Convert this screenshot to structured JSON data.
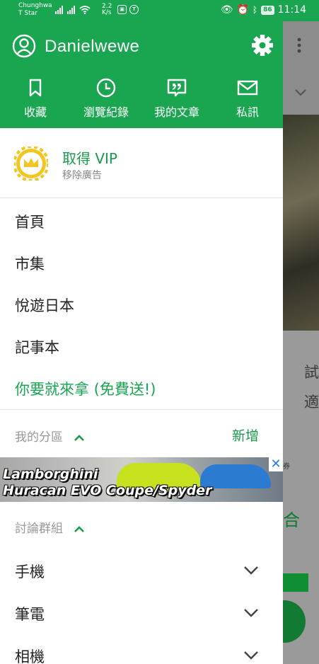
{
  "status_bar": {
    "carrier_line1": "Chunghwa",
    "carrier_line2": "T Star",
    "speed_value": "2.2",
    "speed_unit": "K/s",
    "battery": "86",
    "time": "11:14"
  },
  "drawer": {
    "username": "Danielwewe",
    "header_buttons": [
      {
        "label": "收藏",
        "icon": "bookmark-icon"
      },
      {
        "label": "瀏覽紀錄",
        "icon": "clock-icon"
      },
      {
        "label": "我的文章",
        "icon": "article-quote-icon"
      },
      {
        "label": "私訊",
        "icon": "mail-icon"
      }
    ],
    "vip": {
      "title": "取得 VIP",
      "subtitle": "移除廣告"
    },
    "menu": [
      "首頁",
      "市集",
      "悅遊日本",
      "記事本"
    ],
    "promo": "你要就來拿 (免費送!)",
    "my_boards": {
      "title": "我的分區",
      "add_label": "新增"
    },
    "ad": {
      "line1": "Lamborghini",
      "line2": "Huracan EVO Coupe/Spyder",
      "close": "✕"
    },
    "groups": {
      "title": "討論群組",
      "items": [
        "手機",
        "筆電",
        "相機"
      ]
    }
  },
  "background": {
    "text_line1": "試",
    "text_line2": "適",
    "text_line3": "合",
    "coupon": "券"
  },
  "colors": {
    "brand": "#1aa551",
    "accent_text": "#1a9b4b"
  }
}
